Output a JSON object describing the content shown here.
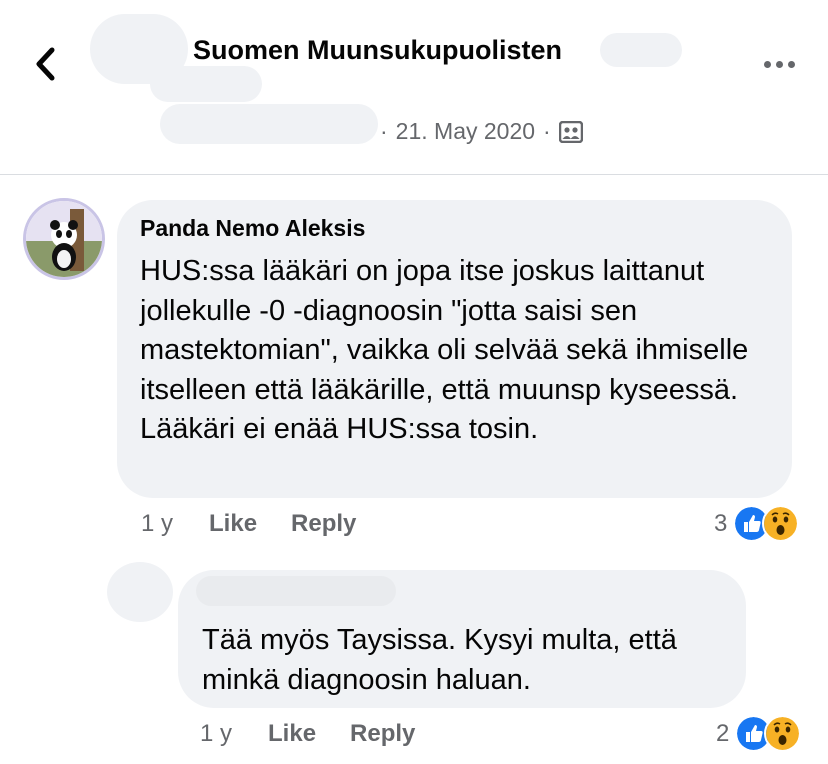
{
  "header": {
    "group_title": "Suomen Muunsukupuolisten",
    "date": "21. May 2020",
    "separator": "·",
    "back_icon": "chevron-left-icon",
    "more_icon": "more-dots-icon",
    "audience_icon": "group-members-icon"
  },
  "comments": [
    {
      "author": "Panda Nemo Aleksis",
      "text": "HUS:ssa lääkäri on jopa itse joskus laittanut jollekulle -0 -diagnoosin \"jotta saisi sen mastektomian\", vaikka oli selvää sekä ihmiselle itselleen että lääkärille, että muunsp kyseessä. Lääkäri ei enää HUS:ssa tosin.",
      "time": "1 y",
      "like_label": "Like",
      "reply_label": "Reply",
      "reaction_count": "3",
      "reactions": [
        "like-reaction-icon",
        "wow-reaction-icon"
      ]
    },
    {
      "author": "",
      "text": "Tää myös Taysissa. Kysyi multa, että minkä diagnoosin haluan.",
      "time": "1 y",
      "like_label": "Like",
      "reply_label": "Reply",
      "reaction_count": "2",
      "reactions": [
        "like-reaction-icon",
        "wow-reaction-icon"
      ]
    }
  ],
  "colors": {
    "bubble": "#f0f2f5",
    "secondary_text": "#65676b",
    "like_blue": "#1877f2",
    "wow_yellow": "#f7b125"
  }
}
